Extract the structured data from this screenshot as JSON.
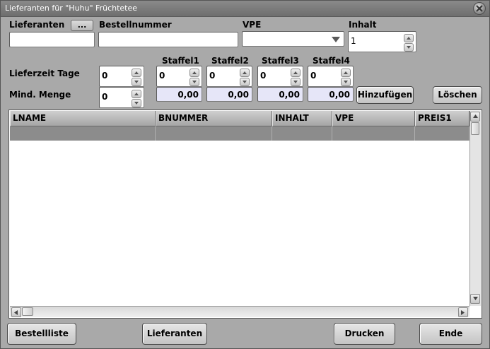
{
  "window": {
    "title": "Lieferanten für \"Huhu\" Früchtetee"
  },
  "form": {
    "lieferanten_label": "Lieferanten",
    "lieferanten_browse": "...",
    "lieferanten_value": "",
    "bestellnummer_label": "Bestellnummer",
    "bestellnummer_value": "",
    "vpe_label": "VPE",
    "vpe_value": "",
    "inhalt_label": "Inhalt",
    "inhalt_value": "1",
    "lieferzeit_label": "Lieferzeit Tage",
    "lieferzeit_value": "0",
    "mindmenge_label": "Mind. Menge",
    "mindmenge_value": "0",
    "staffel": [
      {
        "label": "Staffel1",
        "qty": "0",
        "price": "0,00"
      },
      {
        "label": "Staffel2",
        "qty": "0",
        "price": "0,00"
      },
      {
        "label": "Staffel3",
        "qty": "0",
        "price": "0,00"
      },
      {
        "label": "Staffel4",
        "qty": "0",
        "price": "0,00"
      }
    ],
    "add_label": "Hinzufügen",
    "delete_label": "Löschen"
  },
  "table": {
    "columns": [
      "LNAME",
      "BNUMMER",
      "INHALT",
      "VPE",
      "PREIS1"
    ]
  },
  "footer": {
    "bestellliste_label": "Bestellliste",
    "lieferanten_label": "Lieferanten",
    "drucken_label": "Drucken",
    "ende_label": "Ende"
  },
  "icons": {
    "close": "close-icon",
    "spin_up": "chevron-up-icon",
    "spin_down": "chevron-down-icon",
    "dropdown": "dropdown-arrow-icon"
  },
  "colors": {
    "window_bg": "#a9a9a9",
    "title_bg": "#7c7c7c",
    "price_field_bg": "#e6e6f8",
    "selected_row": "#8c8c8c"
  }
}
